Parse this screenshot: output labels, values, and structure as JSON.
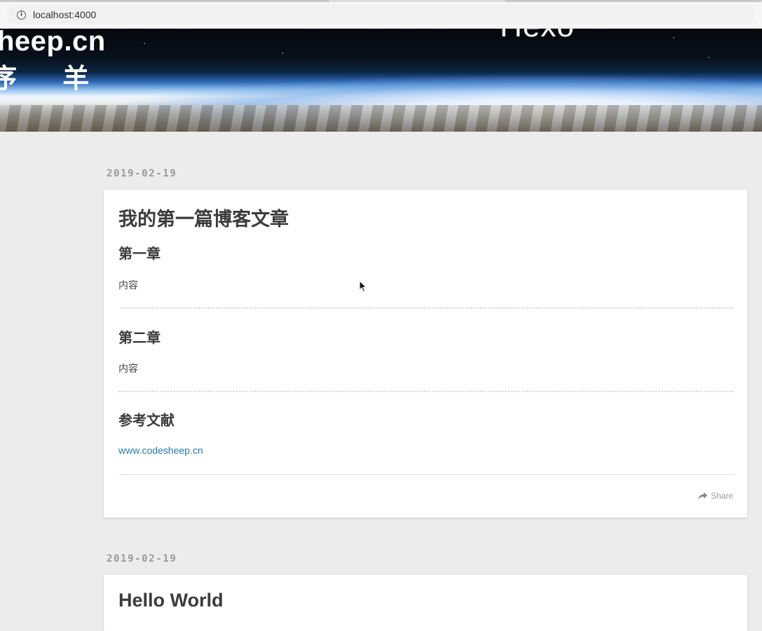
{
  "browser": {
    "url": "localhost:4000"
  },
  "banner": {
    "site_title_en": "heep.cn",
    "site_title_cn": "序 羊",
    "logo_text": "Hexo"
  },
  "posts": [
    {
      "date": "2019-02-19",
      "title": "我的第一篇博客文章",
      "sections": [
        {
          "heading": "第一章",
          "body": "内容"
        },
        {
          "heading": "第二章",
          "body": "内容"
        },
        {
          "heading": "参考文献",
          "link": "www.codesheep.cn"
        }
      ],
      "share_label": "Share"
    },
    {
      "date": "2019-02-19",
      "title": "Hello World"
    }
  ]
}
